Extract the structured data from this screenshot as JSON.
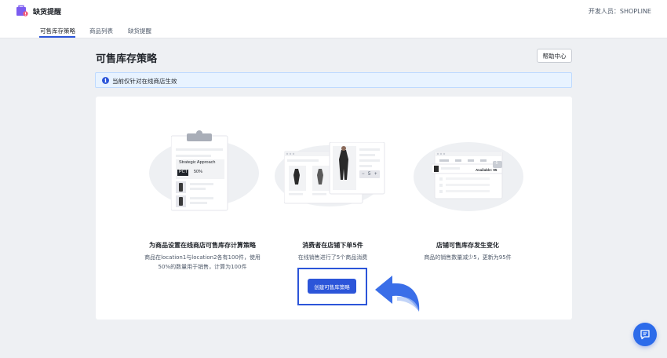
{
  "app": {
    "title": "缺货提醒",
    "developer_label": "开发人员：SHOPLINE"
  },
  "tabs": [
    {
      "label": "可售库存策略",
      "active": true
    },
    {
      "label": "商品列表",
      "active": false
    },
    {
      "label": "缺货提醒",
      "active": false
    }
  ],
  "page": {
    "title": "可售库存策略",
    "help_label": "帮助中心"
  },
  "notice": {
    "icon": "info-icon",
    "text": "当前仅针对在线商店生效"
  },
  "steps": [
    {
      "title": "为商品设置在线商店可售库存计算策略",
      "desc_line1": "商品在location1与location2各有100件，使用",
      "desc_line2": "50%的数量用于销售，计算为100件",
      "illustration": {
        "card_title": "Strategic Approach",
        "badge": "PCT",
        "badge_value": "50%"
      }
    },
    {
      "title": "消费者在店铺下单5件",
      "desc": "在线销售进行了5个商品消费",
      "illustration": {
        "stepper_minus": "−",
        "stepper_value": "5",
        "stepper_plus": "+"
      }
    },
    {
      "title": "店铺可售库存发生变化",
      "desc": "商品的销售数量减少5，更新为95件",
      "illustration": {
        "available_label": "Available: 95",
        "delta_badge": "-5"
      }
    }
  ],
  "actions": {
    "create_label": "创建可售库策略"
  },
  "colors": {
    "primary": "#2c55d9",
    "notice_bg": "#e8f3ff",
    "page_bg": "#eef0f3"
  }
}
